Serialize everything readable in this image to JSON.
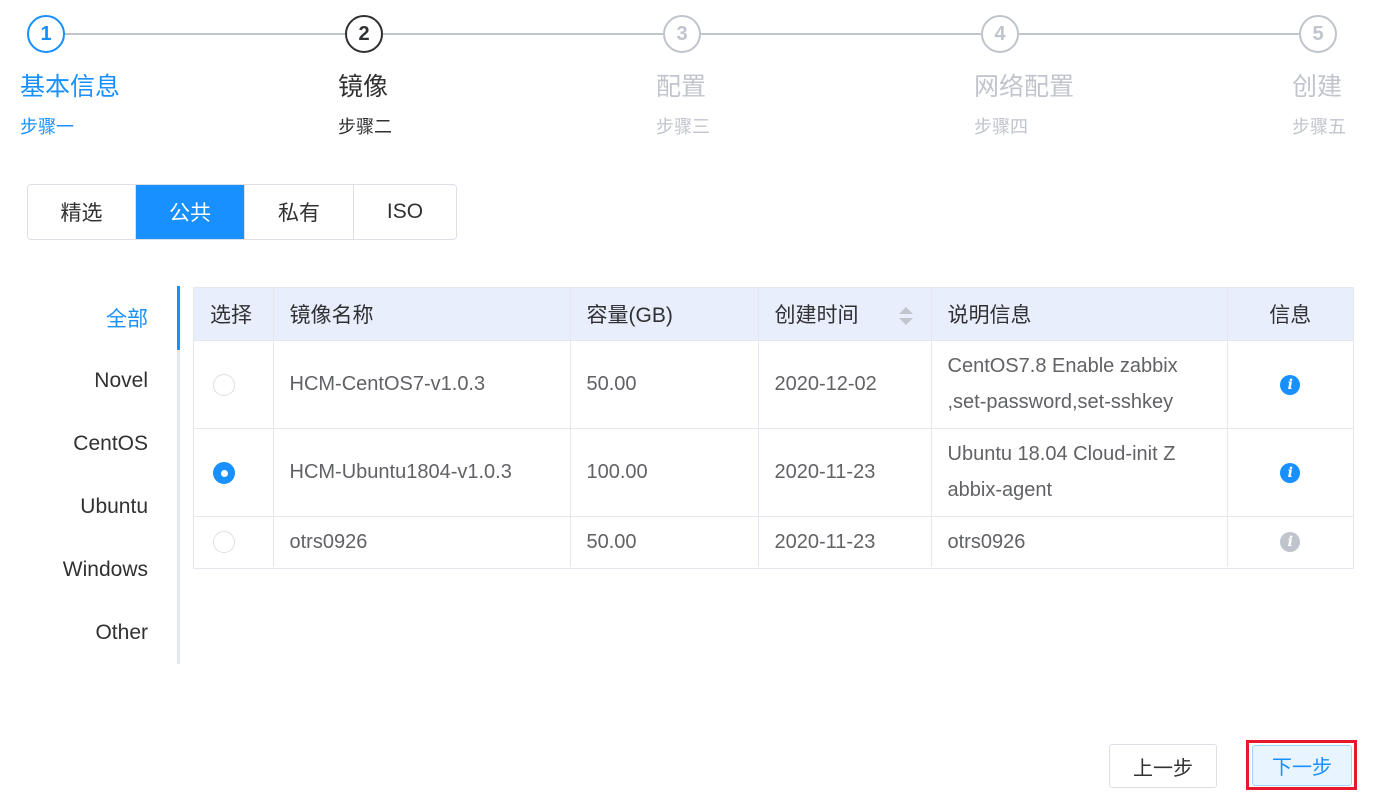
{
  "steps": [
    {
      "number": "1",
      "title": "基本信息",
      "desc": "步骤一",
      "status": "finish"
    },
    {
      "number": "2",
      "title": "镜像",
      "desc": "步骤二",
      "status": "process"
    },
    {
      "number": "3",
      "title": "配置",
      "desc": "步骤三",
      "status": "wait"
    },
    {
      "number": "4",
      "title": "网络配置",
      "desc": "步骤四",
      "status": "wait"
    },
    {
      "number": "5",
      "title": "创建",
      "desc": "步骤五",
      "status": "wait"
    }
  ],
  "tabs": [
    {
      "label": "精选",
      "active": false
    },
    {
      "label": "公共",
      "active": true
    },
    {
      "label": "私有",
      "active": false
    },
    {
      "label": "ISO",
      "active": false
    }
  ],
  "categories": [
    {
      "label": "全部",
      "active": true
    },
    {
      "label": "Novel",
      "active": false
    },
    {
      "label": "CentOS",
      "active": false
    },
    {
      "label": "Ubuntu",
      "active": false
    },
    {
      "label": "Windows",
      "active": false
    },
    {
      "label": "Other",
      "active": false
    }
  ],
  "table": {
    "headers": {
      "select": "选择",
      "name": "镜像名称",
      "capacity": "容量(GB)",
      "created": "创建时间",
      "description": "说明信息",
      "info": "信息"
    },
    "rows": [
      {
        "selected": false,
        "name": "HCM-CentOS7-v1.0.3",
        "capacity": "50.00",
        "created": "2020-12-02",
        "description_lines": [
          "CentOS7.8 Enable zabbix",
          ",set-password,set-sshkey"
        ],
        "info_icon": "info-icon",
        "info_enabled": true
      },
      {
        "selected": true,
        "name": "HCM-Ubuntu1804-v1.0.3",
        "capacity": "100.00",
        "created": "2020-11-23",
        "description_lines": [
          "Ubuntu 18.04 Cloud-init Z",
          "abbix-agent"
        ],
        "info_icon": "info-icon",
        "info_enabled": true
      },
      {
        "selected": false,
        "name": "otrs0926",
        "capacity": "50.00",
        "created": "2020-11-23",
        "description_lines": [
          "otrs0926"
        ],
        "info_icon": "info-icon",
        "info_enabled": false
      }
    ]
  },
  "footer": {
    "prev_label": "上一步",
    "next_label": "下一步"
  },
  "colors": {
    "primary": "#1890ff",
    "highlight_outline": "#e5192b",
    "table_header_bg": "#e8eefc"
  }
}
